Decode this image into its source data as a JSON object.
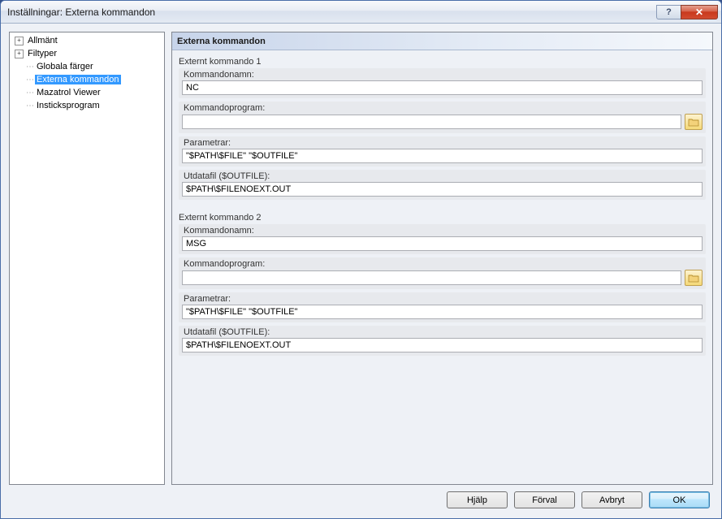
{
  "titlebar": {
    "title": "Inställningar: Externa kommandon",
    "help_glyph": "?",
    "close_glyph": "✕"
  },
  "tree": {
    "items": [
      {
        "label": "Allmänt",
        "expandable": true
      },
      {
        "label": "Filtyper",
        "expandable": true
      },
      {
        "label": "Globala färger",
        "expandable": false
      },
      {
        "label": "Externa kommandon",
        "expandable": false,
        "selected": true
      },
      {
        "label": "Mazatrol Viewer",
        "expandable": false
      },
      {
        "label": "Insticksprogram",
        "expandable": false
      }
    ]
  },
  "panel": {
    "header": "Externa kommandon",
    "groups": [
      {
        "title": "Externt kommando 1",
        "fields": {
          "name_label": "Kommandonamn:",
          "name_value": "NC",
          "program_label": "Kommandoprogram:",
          "program_value": "",
          "params_label": "Parametrar:",
          "params_value": "\"$PATH\\$FILE\" \"$OUTFILE\"",
          "outfile_label": "Utdatafil ($OUTFILE):",
          "outfile_value": "$PATH\\$FILENOEXT.OUT"
        }
      },
      {
        "title": "Externt kommando 2",
        "fields": {
          "name_label": "Kommandonamn:",
          "name_value": "MSG",
          "program_label": "Kommandoprogram:",
          "program_value": "",
          "params_label": "Parametrar:",
          "params_value": "\"$PATH\\$FILE\" \"$OUTFILE\"",
          "outfile_label": "Utdatafil ($OUTFILE):",
          "outfile_value": "$PATH\\$FILENOEXT.OUT"
        }
      }
    ]
  },
  "buttons": {
    "help": "Hjälp",
    "defaults": "Förval",
    "cancel": "Avbryt",
    "ok": "OK"
  }
}
